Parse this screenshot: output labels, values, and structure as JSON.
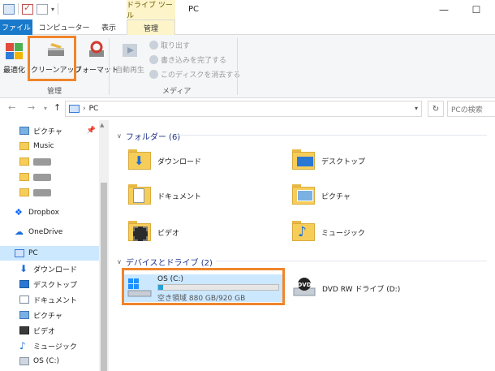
{
  "window": {
    "title": "PC"
  },
  "tabs": {
    "context_group": "ドライブ ツール",
    "file": "ファイル",
    "computer": "コンピューター",
    "view": "表示",
    "manage": "管理"
  },
  "ribbon": {
    "optimize": "最適化",
    "cleanup": "クリーンアップ",
    "format": "フォーマット",
    "group_manage": "管理",
    "autoplay": "自動再生",
    "eject": "取り出す",
    "finish_burning": "書き込みを完了する",
    "erase_disc": "このディスクを消去する",
    "group_media": "メディア"
  },
  "address": {
    "path": "PC",
    "search_placeholder": "PCの検索"
  },
  "nav": {
    "items": [
      {
        "label": "ピクチャ"
      },
      {
        "label": "Music"
      },
      {
        "label": ""
      },
      {
        "label": ""
      },
      {
        "label": ""
      },
      {
        "label": "Dropbox"
      },
      {
        "label": "OneDrive"
      },
      {
        "label": "PC"
      },
      {
        "label": "ダウンロード"
      },
      {
        "label": "デスクトップ"
      },
      {
        "label": "ドキュメント"
      },
      {
        "label": "ピクチャ"
      },
      {
        "label": "ビデオ"
      },
      {
        "label": "ミュージック"
      },
      {
        "label": "OS (C:)"
      }
    ]
  },
  "content": {
    "folders_header": "フォルダー (6)",
    "folders": [
      {
        "label": "ダウンロード"
      },
      {
        "label": "デスクトップ"
      },
      {
        "label": "ドキュメント"
      },
      {
        "label": "ピクチャ"
      },
      {
        "label": "ビデオ"
      },
      {
        "label": "ミュージック"
      }
    ],
    "devices_header": "デバイスとドライブ (2)",
    "drive_c": {
      "name": "OS (C:)",
      "free": "空き領域 880 GB/920 GB",
      "used_fraction": 0.043
    },
    "dvd": {
      "name": "DVD RW ドライブ (D:)",
      "badge": "DVD"
    }
  },
  "colors": {
    "accent": "#1979ca",
    "highlight": "#f0852b",
    "selected": "#cce8ff",
    "drive_fill": "#26a0da"
  }
}
